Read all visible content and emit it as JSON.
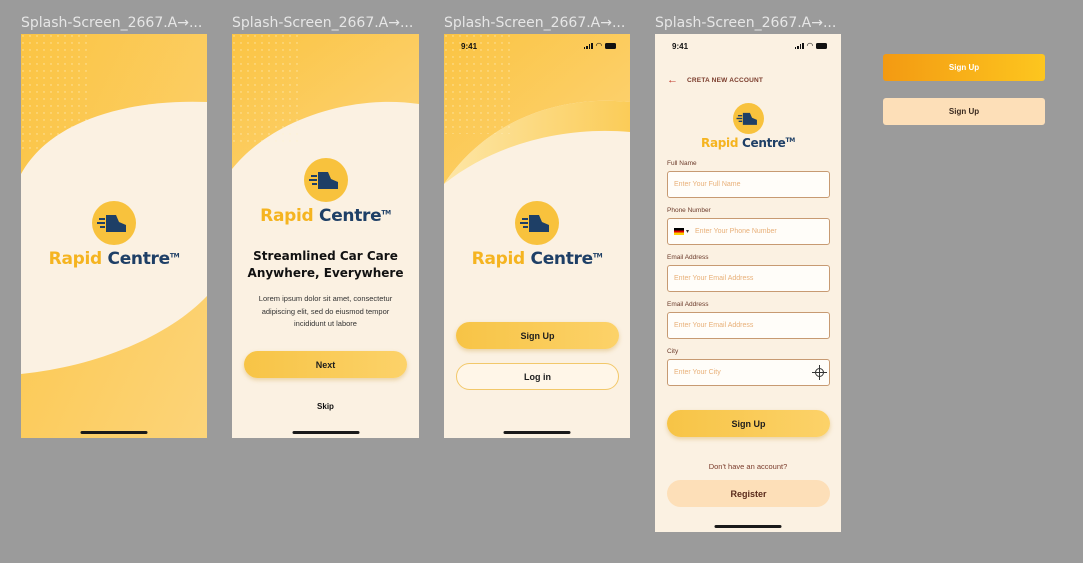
{
  "frames": [
    {
      "label": "Splash-Screen_2667.A→..."
    },
    {
      "label": "Splash-Screen_2667.A→..."
    },
    {
      "label": "Splash-Screen_2667.A→..."
    },
    {
      "label": "Splash-Screen_2667.A→..."
    }
  ],
  "brand": {
    "word1": "Rapid",
    "word2": "Centre",
    "tm": "TM"
  },
  "onboarding": {
    "heading_line1": "Streamlined Car Care",
    "heading_line2": "Anywhere, Everywhere",
    "body_line1": "Lorem ipsum dolor sit amet, consectetur",
    "body_line2": "adipiscing elit, sed do eiusmod tempor",
    "body_line3": "incididunt ut labore",
    "next_label": "Next",
    "skip_label": "Skip"
  },
  "status": {
    "time": "9:41"
  },
  "welcome": {
    "signup_label": "Sign Up",
    "login_label": "Log in"
  },
  "register": {
    "title": "CRETA NEW ACCOUNT",
    "fields": [
      {
        "label": "Full Name",
        "placeholder": "Enter Your Full Name"
      },
      {
        "label": "Phone Number",
        "placeholder": "Enter Your Phone Number"
      },
      {
        "label": "Email Address",
        "placeholder": "Enter Your Email Address"
      },
      {
        "label": "Email Address",
        "placeholder": "Enter Your Email Address"
      },
      {
        "label": "City",
        "placeholder": "Enter Your City"
      }
    ],
    "signup_label": "Sign Up",
    "no_account_text": "Don't have an account?",
    "register_label": "Register"
  },
  "components": {
    "signup_primary": "Sign Up",
    "signup_light": "Sign Up"
  },
  "colors": {
    "brand_yellow": "#f8c23d",
    "brand_navy": "#1e3f66",
    "cream": "#fbf1e2",
    "canvas": "#9b9b9b"
  },
  "icons": [
    "back-arrow-icon",
    "car-logo-icon",
    "signal-icon",
    "wifi-icon",
    "battery-icon",
    "germany-flag-icon",
    "chevron-down-icon",
    "location-target-icon"
  ]
}
